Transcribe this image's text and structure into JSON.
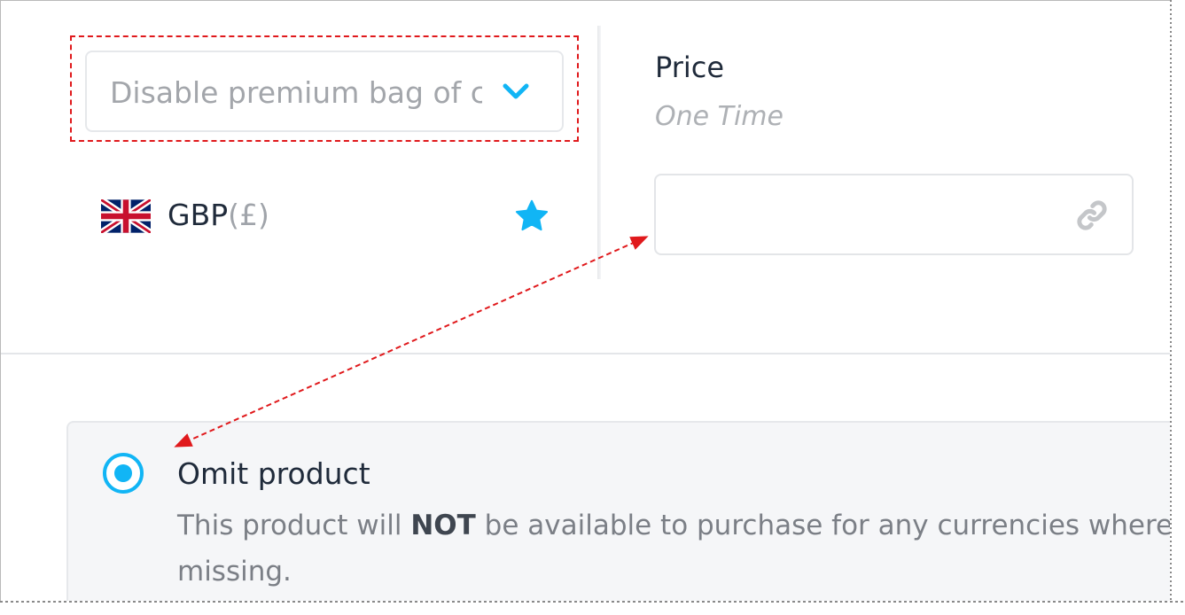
{
  "selector": {
    "value": "Disable premium bag of c",
    "icon": "chevron-down-icon"
  },
  "currency": {
    "flag": "uk-flag-icon",
    "code": "GBP",
    "symbol": "(£)",
    "favorite_icon": "star-icon"
  },
  "price": {
    "label": "Price",
    "subtitle": "One Time",
    "input_value": "",
    "input_icon": "link-icon"
  },
  "option": {
    "selected": true,
    "title": "Omit product",
    "desc_before": "This product will ",
    "desc_bold": "NOT",
    "desc_after": " be available to purchase for any currencies where th",
    "desc_line2": "missing."
  },
  "colors": {
    "accent": "#11b5f5",
    "annotation": "#e0191c"
  }
}
